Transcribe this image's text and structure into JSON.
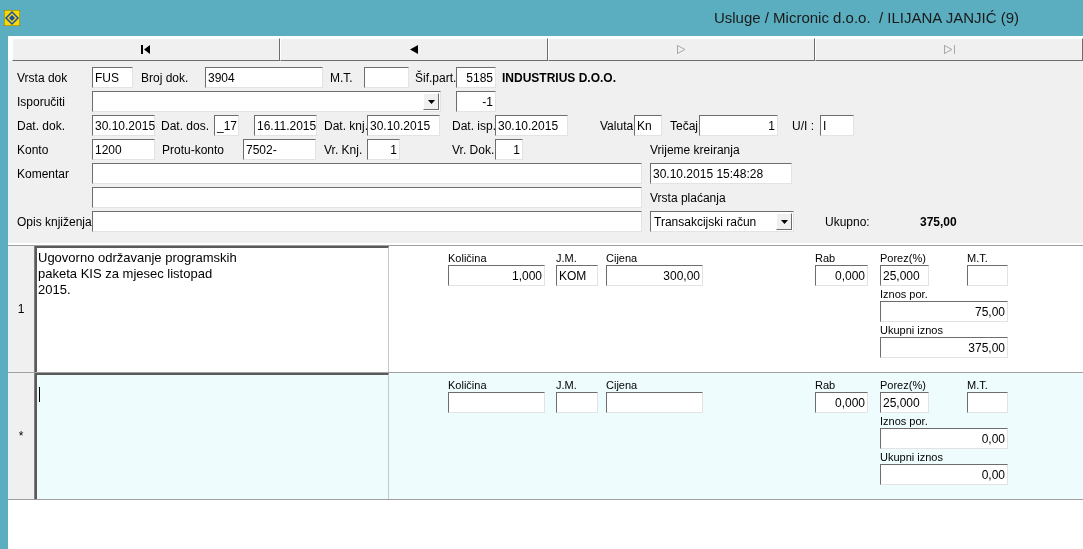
{
  "window": {
    "title": "Usluge / Micronic d.o.o.  / ILIJANA JANJIĆ (9)"
  },
  "nav_buttons": [
    {
      "kind": "first",
      "disabled": false
    },
    {
      "kind": "previous",
      "disabled": false
    },
    {
      "kind": "next",
      "disabled": true
    },
    {
      "kind": "last",
      "disabled": true
    }
  ],
  "header_rows": [
    [
      {
        "kind": "label",
        "text": "Vrsta dok"
      },
      {
        "kind": "field",
        "value": "FUS"
      },
      {
        "kind": "label",
        "text": "Broj dok."
      },
      {
        "kind": "field",
        "value": "3904"
      },
      {
        "kind": "label",
        "text": "M.T."
      },
      {
        "kind": "field"
      },
      {
        "kind": "label",
        "text": "Šif.part."
      },
      {
        "kind": "field",
        "value": "5185"
      },
      {
        "kind": "bold",
        "text": "INDUSTRIUS D.O.O."
      }
    ],
    [
      {
        "kind": "label",
        "text": "Isporučiti"
      },
      {
        "kind": "dropdown"
      },
      {
        "kind": "field",
        "value": "-1"
      }
    ],
    [
      {
        "kind": "label",
        "text": "Dat. dok."
      },
      {
        "kind": "field",
        "value": "30.10.2015"
      },
      {
        "kind": "label",
        "text": "Dat. dos."
      },
      {
        "kind": "field",
        "value": "_17"
      },
      {
        "kind": "field",
        "value": "16.11.2015"
      },
      {
        "kind": "label",
        "text": "Dat. knj."
      },
      {
        "kind": "field",
        "value": "30.10.2015"
      },
      {
        "kind": "label",
        "text": "Dat. isp."
      },
      {
        "kind": "field",
        "value": "30.10.2015"
      },
      {
        "kind": "label",
        "text": "Valuta"
      },
      {
        "kind": "field",
        "value": "Kn"
      },
      {
        "kind": "label",
        "text": "Tečaj"
      },
      {
        "kind": "field",
        "value": "1"
      },
      {
        "kind": "label",
        "text": "U/I :"
      },
      {
        "kind": "field",
        "value": "I"
      }
    ],
    [
      {
        "kind": "label",
        "text": "Konto"
      },
      {
        "kind": "field",
        "value": "1200"
      },
      {
        "kind": "label",
        "text": "Protu-konto"
      },
      {
        "kind": "field",
        "value": "7502-"
      },
      {
        "kind": "label",
        "text": "Vr. Knj."
      },
      {
        "kind": "field",
        "value": "1"
      },
      {
        "kind": "label",
        "text": "Vr. Dok."
      },
      {
        "kind": "field",
        "value": "1"
      },
      {
        "kind": "label",
        "text": "Vrijeme kreiranja"
      }
    ],
    [
      {
        "kind": "label",
        "text": "Komentar"
      },
      {
        "kind": "field"
      },
      {
        "kind": "field",
        "value": "30.10.2015 15:48:28"
      }
    ],
    [
      {
        "kind": "field"
      },
      {
        "kind": "label",
        "text": "Vrsta plaćanja"
      }
    ],
    [
      {
        "kind": "label",
        "text": "Opis knjiženja"
      },
      {
        "kind": "field"
      },
      {
        "kind": "dropdown",
        "value": "Transakcijski račun"
      },
      {
        "kind": "label",
        "text": "Ukupno:"
      },
      {
        "kind": "bold",
        "text": "375,00"
      }
    ]
  ],
  "lines": [
    {
      "number": "1",
      "new": false,
      "active": false,
      "description": "Ugovorno održavanje programskih\npaketa KIS za mjesec listopad\n2015.",
      "fields": [
        {
          "label": "Količina",
          "value": "1,000"
        },
        {
          "label": "J.M.",
          "value": "KOM"
        },
        {
          "label": "Cijena",
          "value": "300,00"
        },
        {
          "label": "Rab",
          "value": "0,000"
        },
        {
          "label": "Porez(%)",
          "value": "25,000"
        },
        {
          "label": "M.T."
        },
        {
          "label": "Iznos por.",
          "value": "75,00"
        },
        {
          "label": "Ukupni iznos",
          "value": "375,00"
        }
      ]
    },
    {
      "number": "*",
      "new": true,
      "active": true,
      "fields": [
        {
          "label": "Količina"
        },
        {
          "label": "J.M."
        },
        {
          "label": "Cijena"
        },
        {
          "label": "Rab",
          "value": "0,000"
        },
        {
          "label": "Porez(%)",
          "value": "25,000"
        },
        {
          "label": "M.T."
        },
        {
          "label": "Iznos por.",
          "value": "0,00"
        },
        {
          "label": "Ukupni iznos",
          "value": "0,00"
        }
      ]
    }
  ]
}
